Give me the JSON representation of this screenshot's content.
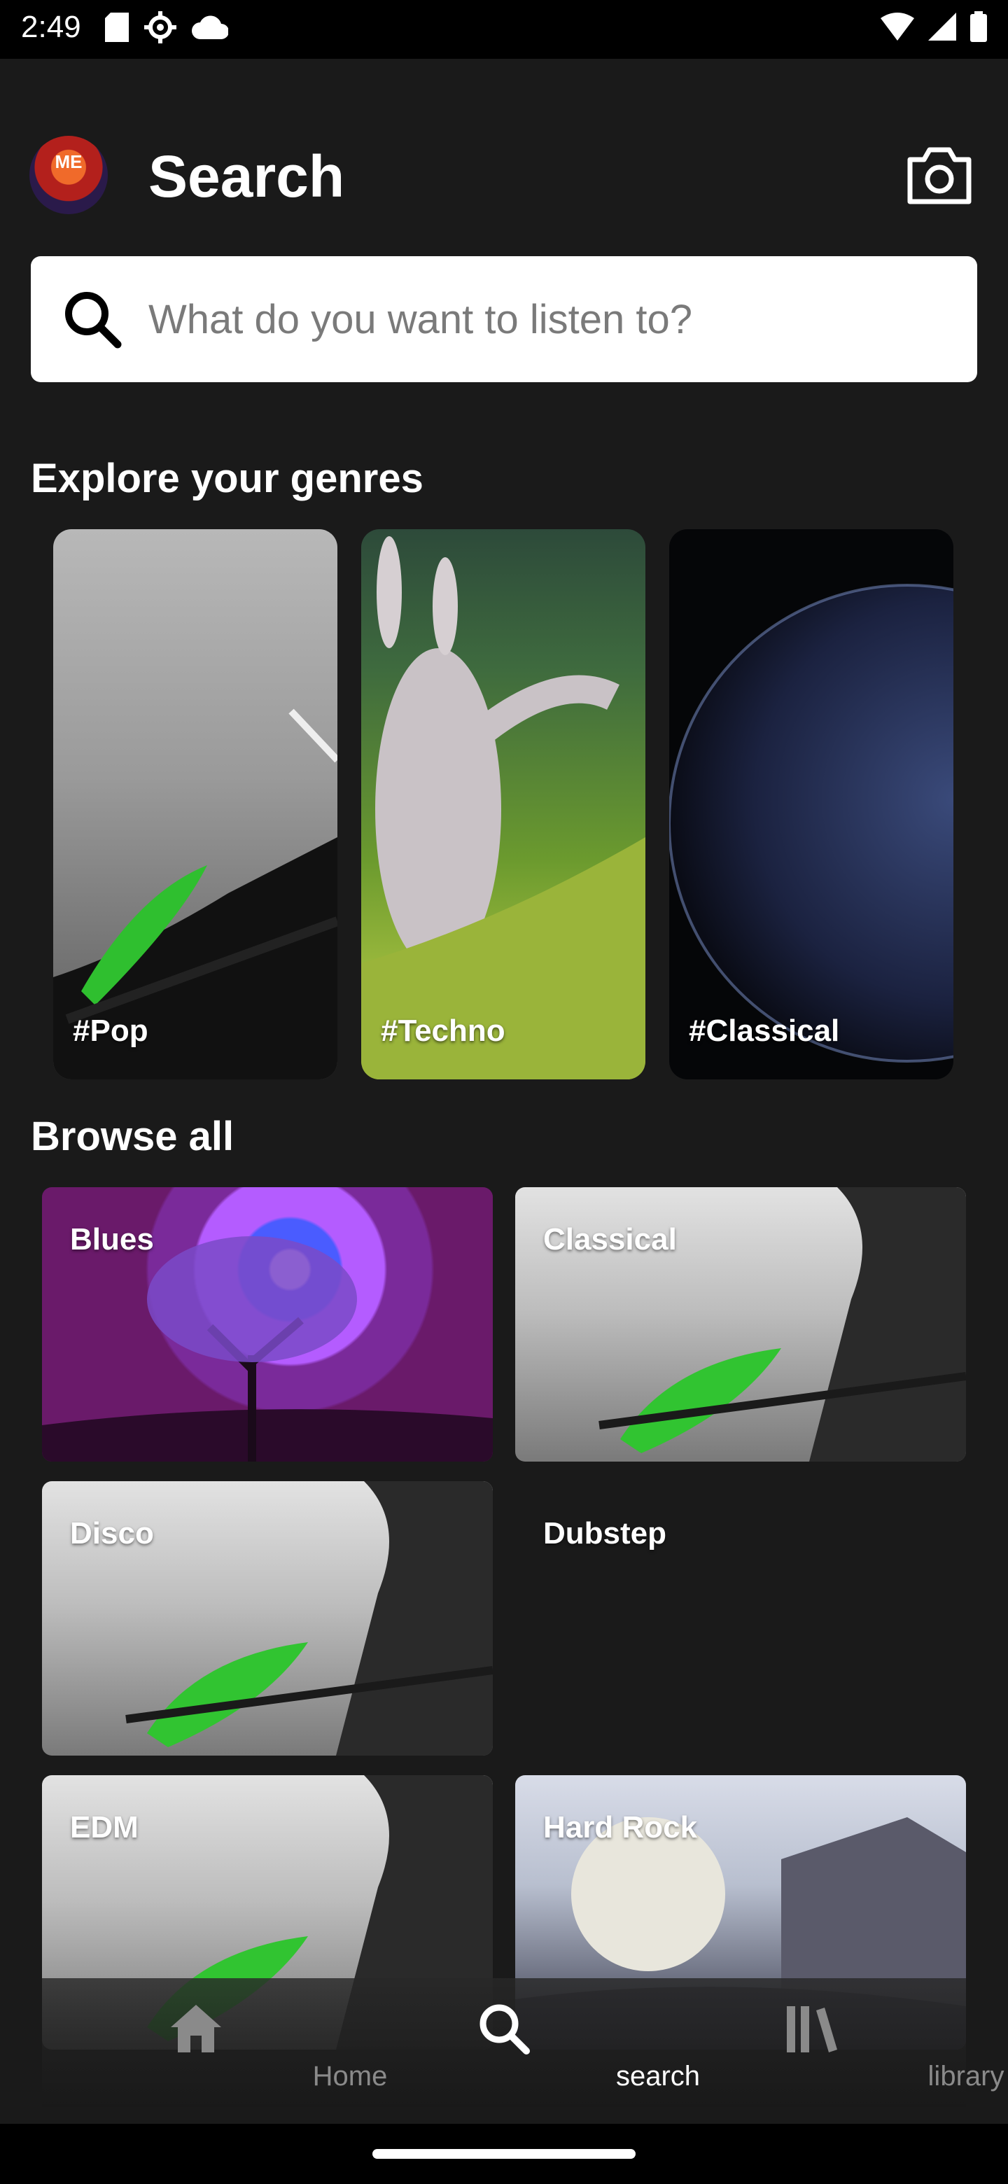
{
  "status_bar": {
    "time": "2:49",
    "left_icons": [
      "sd-card-icon",
      "settings-icon",
      "cloud-icon"
    ],
    "right_icons": [
      "wifi-icon",
      "signal-icon",
      "battery-icon"
    ]
  },
  "header": {
    "title": "Search",
    "avatar_text": "ME",
    "camera_icon": "camera-icon"
  },
  "search": {
    "placeholder": "What do you want to listen to?",
    "value": ""
  },
  "genres": {
    "title": "Explore your genres",
    "items": [
      {
        "label": "#Pop"
      },
      {
        "label": "#Techno"
      },
      {
        "label": "#Classical"
      }
    ]
  },
  "browse": {
    "title": "Browse all",
    "items": [
      {
        "label": "Blues"
      },
      {
        "label": "Classical"
      },
      {
        "label": "Disco"
      },
      {
        "label": "Dubstep"
      },
      {
        "label": "EDM"
      },
      {
        "label": "Hard Rock"
      }
    ]
  },
  "bottom_nav": {
    "items": [
      {
        "label": "Home",
        "icon": "home-icon",
        "active": false
      },
      {
        "label": "search",
        "icon": "search-icon",
        "active": true
      },
      {
        "label": "library",
        "icon": "library-icon",
        "active": false
      }
    ]
  },
  "colors": {
    "background": "#1a1a1a",
    "search_bg": "#ffffff",
    "active_nav": "#ffffff",
    "inactive_nav": "#8a8a8a"
  }
}
